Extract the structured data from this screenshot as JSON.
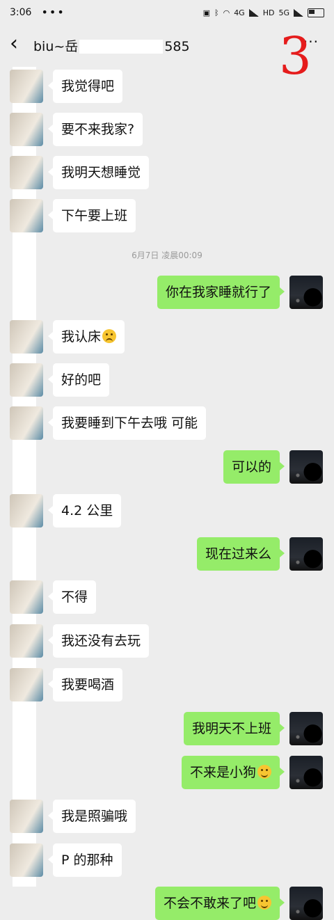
{
  "status_bar": {
    "time": "3:06",
    "dots": "•••",
    "net_1": "4G",
    "net_2": "HD",
    "net_3": "5G"
  },
  "header": {
    "back_icon": "chevron-left-icon",
    "title_prefix": "biu~岳",
    "title_suffix": "585",
    "more": "···"
  },
  "annotation": {
    "number": "3"
  },
  "timestamp": "6月7日 凌晨00:09",
  "messages": [
    {
      "side": "recv",
      "text": "我觉得吧"
    },
    {
      "side": "recv",
      "text": "要不来我家?"
    },
    {
      "side": "recv",
      "text": "我明天想睡觉"
    },
    {
      "side": "recv",
      "text": "下午要上班"
    },
    {
      "side": "sent",
      "text": "你在我家睡就行了"
    },
    {
      "side": "recv",
      "text": "我认床",
      "emoji": "frown-emoji"
    },
    {
      "side": "recv",
      "text": "好的吧"
    },
    {
      "side": "recv",
      "text": "我要睡到下午去哦 可能"
    },
    {
      "side": "sent",
      "text": "可以的"
    },
    {
      "side": "recv",
      "text": "4.2 公里"
    },
    {
      "side": "sent",
      "text": "现在过来么"
    },
    {
      "side": "recv",
      "text": "不得"
    },
    {
      "side": "recv",
      "text": "我还没有去玩"
    },
    {
      "side": "recv",
      "text": "我要喝酒"
    },
    {
      "side": "sent",
      "text": "我明天不上班"
    },
    {
      "side": "sent",
      "text": "不来是小狗",
      "emoji": "smile-emoji"
    },
    {
      "side": "recv",
      "text": "我是照骗哦"
    },
    {
      "side": "recv",
      "text": "P 的那种"
    },
    {
      "side": "sent",
      "text": "不会不敢来了吧",
      "emoji": "smile-emoji"
    }
  ],
  "colors": {
    "background": "#ededed",
    "sent_bubble": "#95ec69",
    "recv_bubble": "#ffffff",
    "annotation": "#e51c1c"
  }
}
